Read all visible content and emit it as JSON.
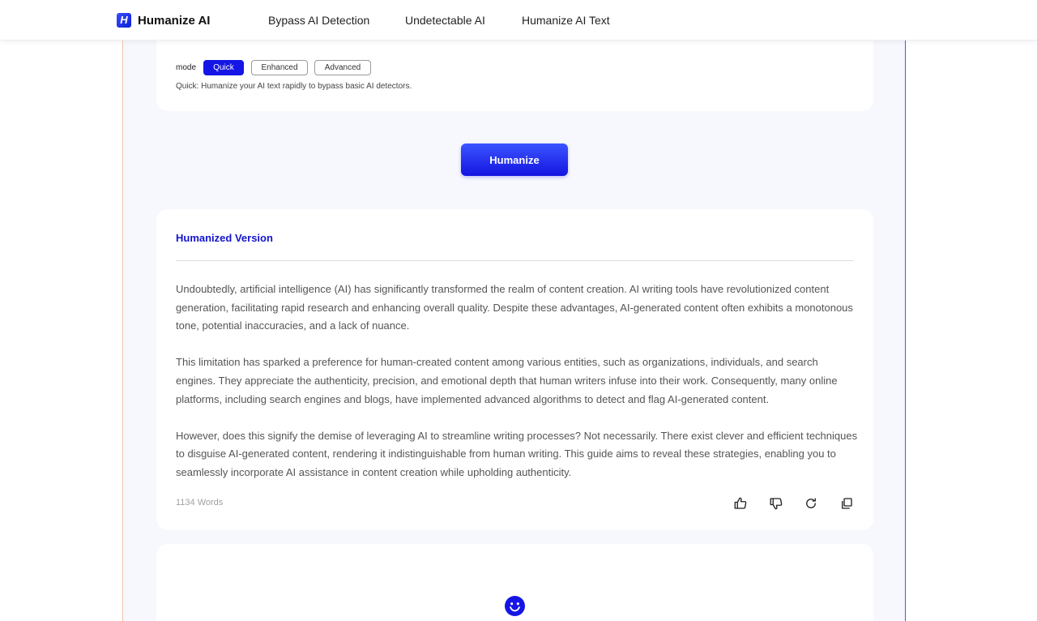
{
  "header": {
    "logo_letter": "H",
    "brand": "Humanize AI",
    "nav": [
      "Bypass AI Detection",
      "Undetectable AI",
      "Humanize AI Text"
    ]
  },
  "mode": {
    "label": "mode",
    "options": [
      "Quick",
      "Enhanced",
      "Advanced"
    ],
    "selected": "Quick",
    "description": "Quick: Humanize your AI text rapidly to bypass basic AI detectors."
  },
  "action": {
    "humanize_label": "Humanize"
  },
  "result": {
    "title": "Humanized Version",
    "paragraphs": [
      "Undoubtedly, artificial intelligence (AI) has significantly transformed the realm of content creation. AI writing tools have revolutionized content generation, facilitating rapid research and enhancing overall quality. Despite these advantages, AI-generated content often exhibits a monotonous tone, potential inaccuracies, and a lack of nuance.",
      "This limitation has sparked a preference for human-created content among various entities, such as organizations, individuals, and search engines. They appreciate the authenticity, precision, and emotional depth that human writers infuse into their work. Consequently, many online platforms, including search engines and blogs, have implemented advanced algorithms to detect and flag AI-generated content.",
      "However, does this signify the demise of leveraging AI to streamline writing processes? Not necessarily. There exist clever and efficient techniques to disguise AI-generated content, rendering it indistinguishable from human writing. This guide aims to reveal these strategies, enabling you to seamlessly incorporate AI assistance in content creation while upholding authenticity."
    ],
    "word_count": "1134 Words",
    "icons": [
      "thumbs-up-icon",
      "thumbs-down-icon",
      "regenerate-icon",
      "copy-icon"
    ]
  },
  "colors": {
    "accent": "#1515e6",
    "title_blue": "#1414d0",
    "page_bg": "#f7f8fd"
  }
}
